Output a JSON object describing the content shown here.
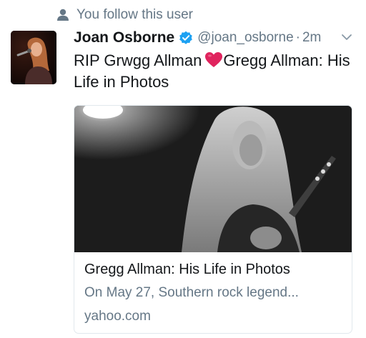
{
  "context": {
    "text": "You follow this user",
    "icon": "person-icon"
  },
  "tweet": {
    "name": "Joan Osborne",
    "handle": "@joan_osborne",
    "separator": "·",
    "time": "2m",
    "text_part1": "RIP Grwgg Allman",
    "text_part2": "Gregg Allman: His Life in Photos",
    "verified_color": "#1da1f2",
    "heart_color": "#e0245e"
  },
  "card": {
    "title": "Gregg Allman: His Life in Photos",
    "description": "On May 27, Southern rock legend...",
    "domain": "yahoo.com"
  }
}
